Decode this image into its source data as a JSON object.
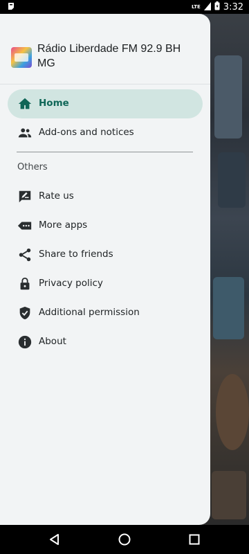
{
  "status_bar": {
    "time": "3:32",
    "network": "LTE",
    "icons": [
      "notification-icon",
      "signal-icon",
      "battery-icon"
    ]
  },
  "drawer": {
    "app_title": "Rádio Liberdade FM 92.9 BH MG",
    "items": [
      {
        "label": "Home",
        "icon": "home-icon",
        "active": true
      },
      {
        "label": "Add-ons and notices",
        "icon": "group-icon",
        "active": false
      }
    ],
    "section_label": "Others",
    "others": [
      {
        "label": "Rate us",
        "icon": "rate-icon"
      },
      {
        "label": "More apps",
        "icon": "more-apps-icon"
      },
      {
        "label": "Share to friends",
        "icon": "share-icon"
      },
      {
        "label": "Privacy policy",
        "icon": "lock-icon"
      },
      {
        "label": "Additional permission",
        "icon": "shield-icon"
      },
      {
        "label": "About",
        "icon": "info-icon"
      }
    ]
  },
  "colors": {
    "accent": "#0f6657",
    "active_bg": "#d1e5e1",
    "drawer_bg": "#f2f4f5"
  },
  "navigation_bar": {
    "buttons": [
      "back-icon",
      "home-circle-icon",
      "recents-icon"
    ]
  }
}
